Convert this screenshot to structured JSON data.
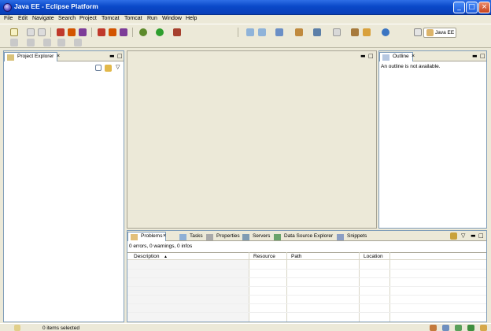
{
  "window": {
    "title": "Java EE - Eclipse Platform"
  },
  "menu": [
    "File",
    "Edit",
    "Navigate",
    "Search",
    "Project",
    "Tomcat",
    "Tomcat",
    "Run",
    "Window",
    "Help"
  ],
  "perspective": {
    "label": "Java EE"
  },
  "project_explorer": {
    "tab_label": "Project Explorer"
  },
  "outline": {
    "tab_label": "Outline",
    "message": "An outline is not available."
  },
  "bottom_tabs": [
    "Problems",
    "Tasks",
    "Properties",
    "Servers",
    "Data Source Explorer",
    "Snippets"
  ],
  "problems": {
    "summary": "0 errors, 0 warnings, 0 infos",
    "columns": [
      "Description",
      "Resource",
      "Path",
      "Location"
    ]
  },
  "status": {
    "text": "0 items selected"
  },
  "colors": {
    "titlebar": "#0a49c9",
    "chrome": "#ece9d8",
    "view_border": "#7f9db9"
  }
}
